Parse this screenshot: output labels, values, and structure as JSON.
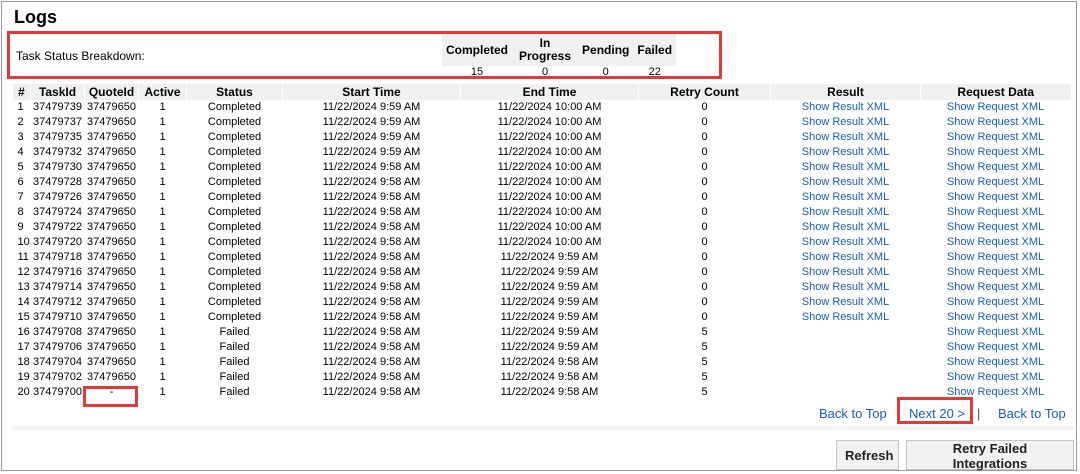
{
  "page": {
    "title": "Logs"
  },
  "breakdown": {
    "label": "Task Status Breakdown:",
    "headers": [
      "Completed",
      "In Progress",
      "Pending",
      "Failed"
    ],
    "values": [
      "15",
      "0",
      "0",
      "22"
    ]
  },
  "table": {
    "headers": [
      "#",
      "TaskId",
      "QuoteId",
      "Active",
      "Status",
      "Start Time",
      "End Time",
      "Retry Count",
      "Result",
      "Request Data"
    ],
    "rows": [
      [
        "1",
        "37479739",
        "37479650",
        "1",
        "Completed",
        "11/22/2024 9:59 AM",
        "11/22/2024 10:00 AM",
        "0",
        "Show Result XML",
        "Show Request XML"
      ],
      [
        "2",
        "37479737",
        "37479650",
        "1",
        "Completed",
        "11/22/2024 9:59 AM",
        "11/22/2024 10:00 AM",
        "0",
        "Show Result XML",
        "Show Request XML"
      ],
      [
        "3",
        "37479735",
        "37479650",
        "1",
        "Completed",
        "11/22/2024 9:59 AM",
        "11/22/2024 10:00 AM",
        "0",
        "Show Result XML",
        "Show Request XML"
      ],
      [
        "4",
        "37479732",
        "37479650",
        "1",
        "Completed",
        "11/22/2024 9:59 AM",
        "11/22/2024 10:00 AM",
        "0",
        "Show Result XML",
        "Show Request XML"
      ],
      [
        "5",
        "37479730",
        "37479650",
        "1",
        "Completed",
        "11/22/2024 9:58 AM",
        "11/22/2024 10:00 AM",
        "0",
        "Show Result XML",
        "Show Request XML"
      ],
      [
        "6",
        "37479728",
        "37479650",
        "1",
        "Completed",
        "11/22/2024 9:58 AM",
        "11/22/2024 10:00 AM",
        "0",
        "Show Result XML",
        "Show Request XML"
      ],
      [
        "7",
        "37479726",
        "37479650",
        "1",
        "Completed",
        "11/22/2024 9:58 AM",
        "11/22/2024 10:00 AM",
        "0",
        "Show Result XML",
        "Show Request XML"
      ],
      [
        "8",
        "37479724",
        "37479650",
        "1",
        "Completed",
        "11/22/2024 9:58 AM",
        "11/22/2024 10:00 AM",
        "0",
        "Show Result XML",
        "Show Request XML"
      ],
      [
        "9",
        "37479722",
        "37479650",
        "1",
        "Completed",
        "11/22/2024 9:58 AM",
        "11/22/2024 10:00 AM",
        "0",
        "Show Result XML",
        "Show Request XML"
      ],
      [
        "10",
        "37479720",
        "37479650",
        "1",
        "Completed",
        "11/22/2024 9:58 AM",
        "11/22/2024 10:00 AM",
        "0",
        "Show Result XML",
        "Show Request XML"
      ],
      [
        "11",
        "37479718",
        "37479650",
        "1",
        "Completed",
        "11/22/2024 9:58 AM",
        "11/22/2024 9:59 AM",
        "0",
        "Show Result XML",
        "Show Request XML"
      ],
      [
        "12",
        "37479716",
        "37479650",
        "1",
        "Completed",
        "11/22/2024 9:58 AM",
        "11/22/2024 9:59 AM",
        "0",
        "Show Result XML",
        "Show Request XML"
      ],
      [
        "13",
        "37479714",
        "37479650",
        "1",
        "Completed",
        "11/22/2024 9:58 AM",
        "11/22/2024 9:59 AM",
        "0",
        "Show Result XML",
        "Show Request XML"
      ],
      [
        "14",
        "37479712",
        "37479650",
        "1",
        "Completed",
        "11/22/2024 9:58 AM",
        "11/22/2024 9:59 AM",
        "0",
        "Show Result XML",
        "Show Request XML"
      ],
      [
        "15",
        "37479710",
        "37479650",
        "1",
        "Completed",
        "11/22/2024 9:58 AM",
        "11/22/2024 9:59 AM",
        "0",
        "Show Result XML",
        "Show Request XML"
      ],
      [
        "16",
        "37479708",
        "37479650",
        "1",
        "Failed",
        "11/22/2024 9:58 AM",
        "11/22/2024 9:59 AM",
        "5",
        "",
        "Show Request XML"
      ],
      [
        "17",
        "37479706",
        "37479650",
        "1",
        "Failed",
        "11/22/2024 9:58 AM",
        "11/22/2024 9:59 AM",
        "5",
        "",
        "Show Request XML"
      ],
      [
        "18",
        "37479704",
        "37479650",
        "1",
        "Failed",
        "11/22/2024 9:58 AM",
        "11/22/2024 9:58 AM",
        "5",
        "",
        "Show Request XML"
      ],
      [
        "19",
        "37479702",
        "37479650",
        "1",
        "Failed",
        "11/22/2024 9:58 AM",
        "11/22/2024 9:58 AM",
        "5",
        "",
        "Show Request XML"
      ],
      [
        "20",
        "37479700",
        "-",
        "1",
        "Failed",
        "11/22/2024 9:58 AM",
        "11/22/2024 9:58 AM",
        "5",
        "",
        "Show Request XML"
      ]
    ]
  },
  "pager": {
    "back_to_top_1": "Back to Top",
    "next": "Next 20 >",
    "separator": "|",
    "back_to_top_2": "Back to Top"
  },
  "buttons": {
    "refresh": "Refresh",
    "retry": "Retry Failed Integrations"
  },
  "colors": {
    "highlight": "#e53838",
    "link": "#1a5fb4",
    "header_bg": "#f0f0f0"
  }
}
